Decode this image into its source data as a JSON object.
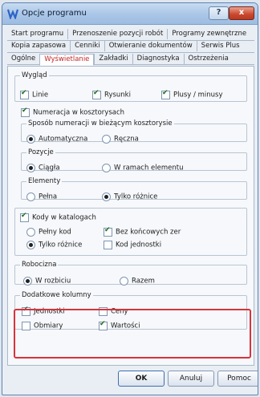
{
  "window": {
    "title": "Opcje programu",
    "help_label": "?",
    "close_label": "x"
  },
  "tabs": {
    "row1": [
      "Start programu",
      "Przenoszenie pozycji robót",
      "Programy zewnętrzne"
    ],
    "row2": [
      "Kopia zapasowa",
      "Cenniki",
      "Otwieranie dokumentów",
      "Serwis Plus"
    ],
    "row3": [
      "Ogólne",
      "Wyświetlanie",
      "Zakładki",
      "Diagnostyka",
      "Ostrzeżenia"
    ],
    "active": "Wyświetlanie"
  },
  "wyglad": {
    "legend": "Wygląd",
    "linie": "Linie",
    "rysunki": "Rysunki",
    "plusy": "Plusy / minusy"
  },
  "numeracja": {
    "label": "Numeracja w kosztorysach",
    "sposob": {
      "legend": "Sposób numeracji w bieżącym kosztorysie",
      "auto": "Automatyczna",
      "reczna": "Ręczna"
    },
    "pozycje": {
      "legend": "Pozycje",
      "ciagla": "Ciągła",
      "w_ramach": "W ramach elementu"
    },
    "elementy": {
      "legend": "Elementy",
      "pelna": "Pełna",
      "tylko": "Tylko różnice"
    }
  },
  "kody": {
    "label": "Kody w katalogach",
    "pelny": "Pełny kod",
    "bez": "Bez końcowych zer",
    "tylko": "Tylko różnice",
    "kod_jedn": "Kod jednostki"
  },
  "robocizna": {
    "legend": "Robocizna",
    "w_rozbiciu": "W rozbiciu",
    "razem": "Razem"
  },
  "dodatkowe": {
    "legend": "Dodatkowe kolumny",
    "jednostki": "Jednostki",
    "ceny": "Ceny",
    "obmiary": "Obmiary",
    "wartosci": "Wartości"
  },
  "buttons": {
    "ok": "OK",
    "anuluj": "Anuluj",
    "pomoc": "Pomoc"
  },
  "accent": {
    "active_tab": "#c42525",
    "highlight": "#d9333b",
    "close_button": "#c9472d"
  }
}
